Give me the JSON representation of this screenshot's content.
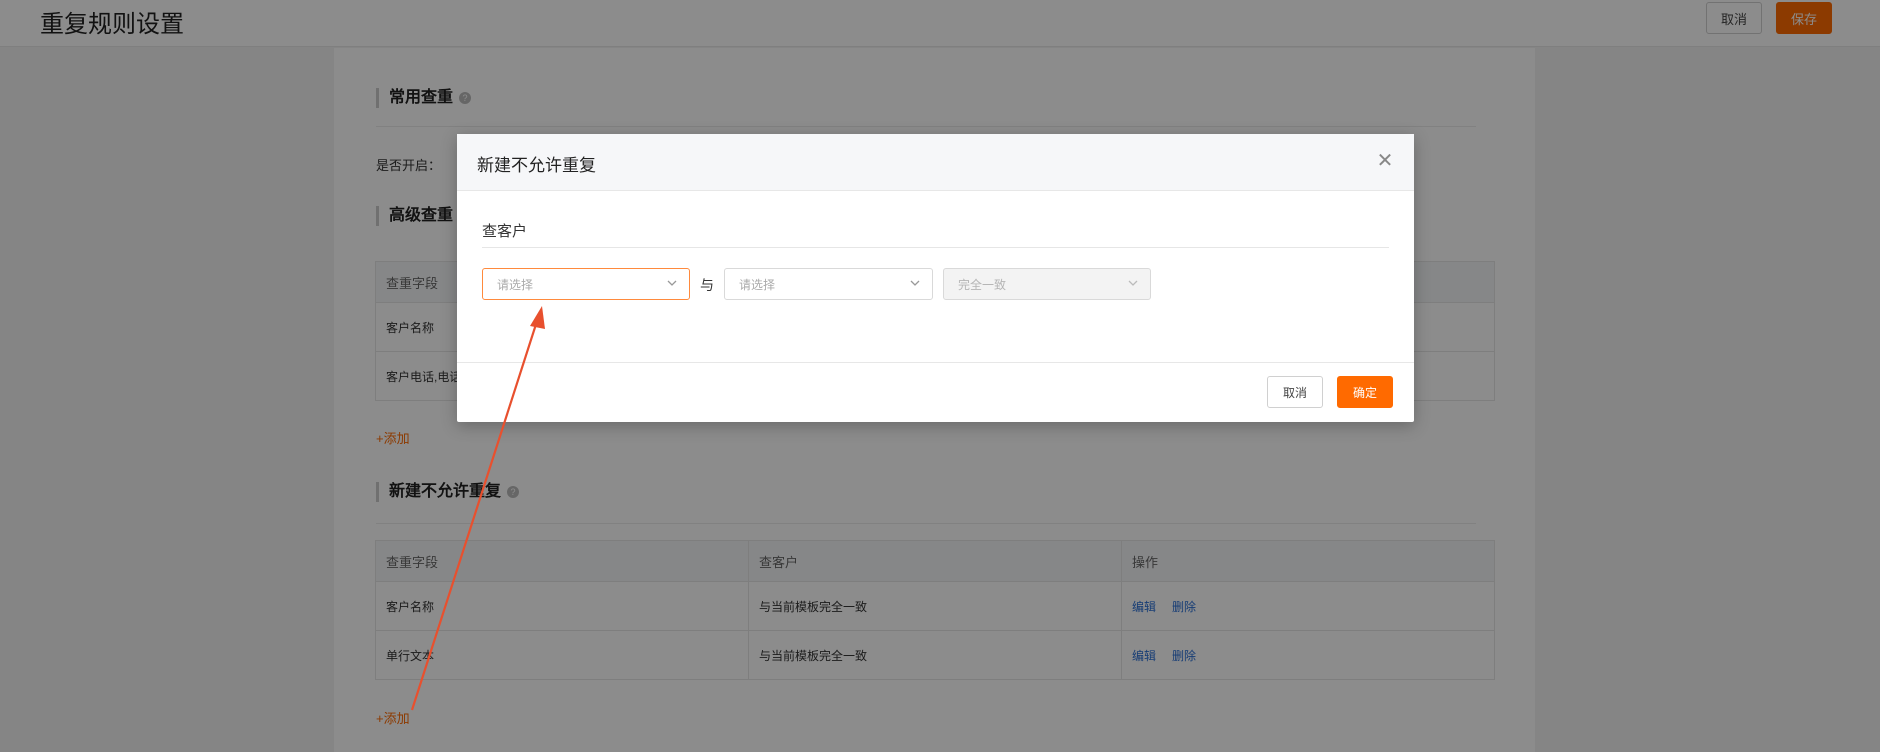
{
  "header": {
    "title": "重复规则设置",
    "cancel_label": "取消",
    "save_label": "保存"
  },
  "common": {
    "title": "常用查重",
    "enable_label": "是否开启："
  },
  "advanced": {
    "title": "高级查重",
    "columns": [
      "查重字段",
      "",
      ""
    ],
    "rows": [
      [
        "客户名称",
        "",
        ""
      ],
      [
        "客户电话,电话",
        "",
        ""
      ]
    ],
    "add_label": "+添加"
  },
  "no_dup": {
    "title": "新建不允许重复",
    "columns": [
      "查重字段",
      "查客户",
      "操作"
    ],
    "rows": [
      {
        "field": "客户名称",
        "rule": "与当前模板完全一致",
        "edit": "编辑",
        "delete": "删除"
      },
      {
        "field": "单行文本",
        "rule": "与当前模板完全一致",
        "edit": "编辑",
        "delete": "删除"
      }
    ],
    "add_label": "+添加"
  },
  "modal": {
    "title": "新建不允许重复",
    "section": "查客户",
    "select1_placeholder": "请选择",
    "connector": "与",
    "select2_placeholder": "请选择",
    "select3_value": "完全一致",
    "cancel_label": "取消",
    "ok_label": "确定"
  },
  "colors": {
    "accent": "#ff6a00",
    "link": "#2a6fd6",
    "arrow": "#e8502e"
  },
  "icons": {
    "close": "close-icon",
    "help": "help-icon",
    "dropdown": "chevron-down-icon"
  }
}
